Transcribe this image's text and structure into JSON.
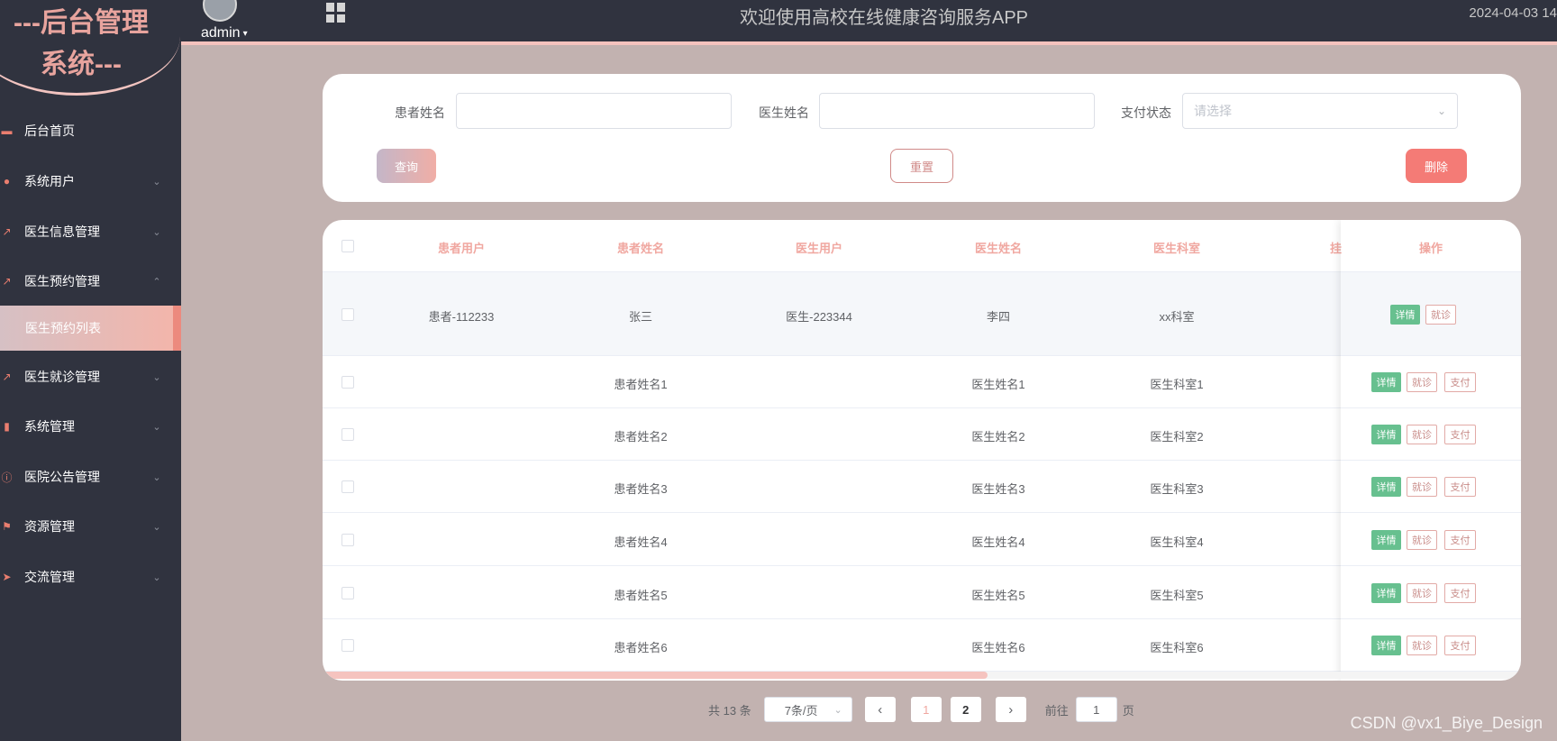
{
  "sidebar": {
    "brand_line1": "---后台管理",
    "brand_line2": "系统---",
    "items": [
      {
        "label": "后台首页",
        "icon": "monitor-icon",
        "arrow": ""
      },
      {
        "label": "系统用户",
        "icon": "user-icon",
        "arrow": "⌄"
      },
      {
        "label": "医生信息管理",
        "icon": "chart-icon",
        "arrow": "⌄"
      },
      {
        "label": "医生预约管理",
        "icon": "chart-icon",
        "arrow": "⌃"
      },
      {
        "label": "医生就诊管理",
        "icon": "chart-icon",
        "arrow": "⌄"
      },
      {
        "label": "系统管理",
        "icon": "bar-chart-icon",
        "arrow": "⌄"
      },
      {
        "label": "医院公告管理",
        "icon": "info-icon",
        "arrow": "⌄"
      },
      {
        "label": "资源管理",
        "icon": "flag-icon",
        "arrow": "⌄"
      },
      {
        "label": "交流管理",
        "icon": "send-icon",
        "arrow": "⌄"
      }
    ],
    "active_sub": "医生预约列表"
  },
  "header": {
    "user": "admin",
    "title": "欢迎使用高校在线健康咨询服务APP",
    "datetime": "2024-04-03 14"
  },
  "search": {
    "patient_name_label": "患者姓名",
    "patient_name_value": "",
    "doctor_name_label": "医生姓名",
    "doctor_name_value": "",
    "pay_status_label": "支付状态",
    "pay_status_placeholder": "请选择",
    "query_label": "查询",
    "reset_label": "重置",
    "delete_label": "删除"
  },
  "table": {
    "headers": [
      "患者用户",
      "患者姓名",
      "医生用户",
      "医生姓名",
      "医生科室",
      "挂",
      "操作"
    ],
    "actions": {
      "detail": "详情",
      "visit": "就诊",
      "pay": "支付"
    },
    "rows": [
      {
        "patient_user": "患者-112233",
        "patient_name": "张三",
        "doctor_user": "医生-223344",
        "doctor_name": "李四",
        "dept": "xx科室",
        "pay": false
      },
      {
        "patient_user": "",
        "patient_name": "患者姓名1",
        "doctor_user": "",
        "doctor_name": "医生姓名1",
        "dept": "医生科室1",
        "pay": true
      },
      {
        "patient_user": "",
        "patient_name": "患者姓名2",
        "doctor_user": "",
        "doctor_name": "医生姓名2",
        "dept": "医生科室2",
        "pay": true
      },
      {
        "patient_user": "",
        "patient_name": "患者姓名3",
        "doctor_user": "",
        "doctor_name": "医生姓名3",
        "dept": "医生科室3",
        "pay": true
      },
      {
        "patient_user": "",
        "patient_name": "患者姓名4",
        "doctor_user": "",
        "doctor_name": "医生姓名4",
        "dept": "医生科室4",
        "pay": true
      },
      {
        "patient_user": "",
        "patient_name": "患者姓名5",
        "doctor_user": "",
        "doctor_name": "医生姓名5",
        "dept": "医生科室5",
        "pay": true
      },
      {
        "patient_user": "",
        "patient_name": "患者姓名6",
        "doctor_user": "",
        "doctor_name": "医生姓名6",
        "dept": "医生科室6",
        "pay": true
      }
    ]
  },
  "pagination": {
    "total": "共 13 条",
    "page_size": "7条/页",
    "pages": [
      "1",
      "2"
    ],
    "current": "1",
    "goto_label": "前往",
    "goto_value": "1",
    "page_suffix": "页"
  },
  "watermark": "CSDN @vx1_Biye_Design",
  "colors": {
    "accent": "#f0a7a0",
    "sidebar_bg": "#30333f",
    "page_bg": "#c2b2b0",
    "detail_green": "#67c08f",
    "delete_red": "#f47b76"
  }
}
